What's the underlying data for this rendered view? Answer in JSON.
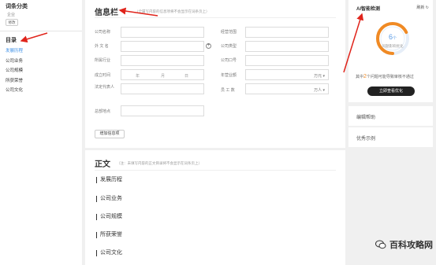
{
  "left": {
    "category_title": "词条分类",
    "category_value": "企业",
    "edit_label": "修改",
    "toc_title": "目录",
    "toc_items": [
      {
        "label": "发展历程",
        "active": true
      },
      {
        "label": "公司业务",
        "active": false
      },
      {
        "label": "公司规模",
        "active": false
      },
      {
        "label": "所获荣誉",
        "active": false
      },
      {
        "label": "公司文化",
        "active": false
      }
    ]
  },
  "info": {
    "title": "信息栏",
    "hint": "（全属写内容的信息项将不会显示在词条页上）",
    "fields": {
      "company_name": {
        "label": "公司名称",
        "value": ""
      },
      "foreign_name": {
        "label": "外 文 名",
        "value": ""
      },
      "industry": {
        "label": "所属行业",
        "value": ""
      },
      "founded": {
        "label": "成立时间",
        "year": "年",
        "month": "月",
        "day": "日"
      },
      "legal_rep": {
        "label": "法定代表人",
        "value": ""
      },
      "hq": {
        "label": "总部地点",
        "value": ""
      },
      "business_scope": {
        "label": "经营范围",
        "value": ""
      },
      "company_type": {
        "label": "公司类型",
        "value": ""
      },
      "company_slogan": {
        "label": "公司口号",
        "value": ""
      },
      "revenue": {
        "label": "年营业额",
        "unit": "万元"
      },
      "employees": {
        "label": "员 工 数",
        "unit": "万人"
      }
    },
    "add_label": "增加信息项"
  },
  "body": {
    "title": "正文",
    "hint": "（注：未填写内容的正文目录将不会显示在词条页上）",
    "items": [
      "发展历程",
      "公司业务",
      "公司规模",
      "所获荣誉",
      "公司文化"
    ]
  },
  "check": {
    "title": "AI智能检测",
    "refresh_label": "刷新",
    "score": "6",
    "score_unit": "个",
    "score_label": "问题影响优化",
    "summary_prefix": "其中",
    "summary_num": "2",
    "summary_suffix": "个问题可能导致审核不通过",
    "button_label": "立即查看优化",
    "progress": 0.68
  },
  "links": {
    "help": "编辑帮助",
    "examples": "优秀示例"
  },
  "watermark": {
    "text": "百科攻略网"
  },
  "colors": {
    "accent_blue": "#3a8ee6",
    "ring_orange": "#f08a24",
    "annotation_red": "#e0241b"
  }
}
